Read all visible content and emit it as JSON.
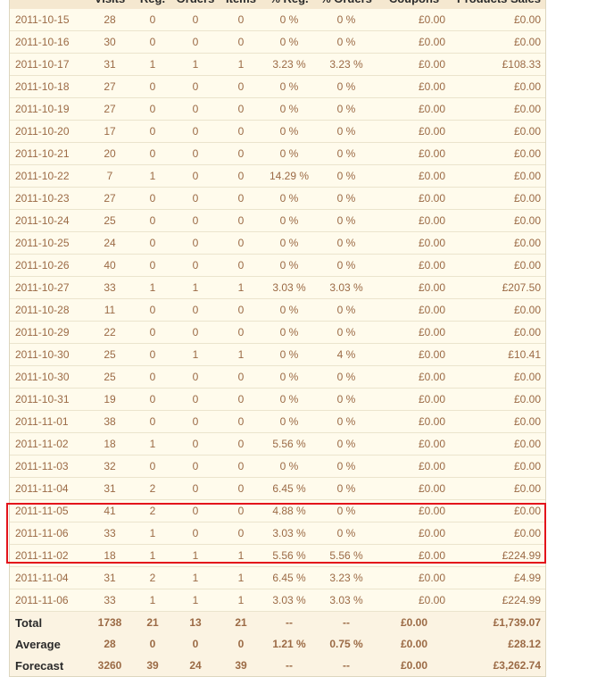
{
  "rows": [
    [
      "2011-10-15",
      "28",
      "0",
      "0",
      "0",
      "0 %",
      "0 %",
      "£0.00",
      "£0.00"
    ],
    [
      "2011-10-16",
      "30",
      "0",
      "0",
      "0",
      "0 %",
      "0 %",
      "£0.00",
      "£0.00"
    ],
    [
      "2011-10-17",
      "31",
      "1",
      "1",
      "1",
      "3.23 %",
      "3.23 %",
      "£0.00",
      "£108.33"
    ],
    [
      "2011-10-18",
      "27",
      "0",
      "0",
      "0",
      "0 %",
      "0 %",
      "£0.00",
      "£0.00"
    ],
    [
      "2011-10-19",
      "27",
      "0",
      "0",
      "0",
      "0 %",
      "0 %",
      "£0.00",
      "£0.00"
    ],
    [
      "2011-10-20",
      "17",
      "0",
      "0",
      "0",
      "0 %",
      "0 %",
      "£0.00",
      "£0.00"
    ],
    [
      "2011-10-21",
      "20",
      "0",
      "0",
      "0",
      "0 %",
      "0 %",
      "£0.00",
      "£0.00"
    ],
    [
      "2011-10-22",
      "7",
      "1",
      "0",
      "0",
      "14.29 %",
      "0 %",
      "£0.00",
      "£0.00"
    ],
    [
      "2011-10-23",
      "27",
      "0",
      "0",
      "0",
      "0 %",
      "0 %",
      "£0.00",
      "£0.00"
    ],
    [
      "2011-10-24",
      "25",
      "0",
      "0",
      "0",
      "0 %",
      "0 %",
      "£0.00",
      "£0.00"
    ],
    [
      "2011-10-25",
      "24",
      "0",
      "0",
      "0",
      "0 %",
      "0 %",
      "£0.00",
      "£0.00"
    ],
    [
      "2011-10-26",
      "40",
      "0",
      "0",
      "0",
      "0 %",
      "0 %",
      "£0.00",
      "£0.00"
    ],
    [
      "2011-10-27",
      "33",
      "1",
      "1",
      "1",
      "3.03 %",
      "3.03 %",
      "£0.00",
      "£207.50"
    ],
    [
      "2011-10-28",
      "11",
      "0",
      "0",
      "0",
      "0 %",
      "0 %",
      "£0.00",
      "£0.00"
    ],
    [
      "2011-10-29",
      "22",
      "0",
      "0",
      "0",
      "0 %",
      "0 %",
      "£0.00",
      "£0.00"
    ],
    [
      "2011-10-30",
      "25",
      "0",
      "1",
      "1",
      "0 %",
      "4 %",
      "£0.00",
      "£10.41"
    ],
    [
      "2011-10-30",
      "25",
      "0",
      "0",
      "0",
      "0 %",
      "0 %",
      "£0.00",
      "£0.00"
    ],
    [
      "2011-10-31",
      "19",
      "0",
      "0",
      "0",
      "0 %",
      "0 %",
      "£0.00",
      "£0.00"
    ],
    [
      "2011-11-01",
      "38",
      "0",
      "0",
      "0",
      "0 %",
      "0 %",
      "£0.00",
      "£0.00"
    ],
    [
      "2011-11-02",
      "18",
      "1",
      "0",
      "0",
      "5.56 %",
      "0 %",
      "£0.00",
      "£0.00"
    ],
    [
      "2011-11-03",
      "32",
      "0",
      "0",
      "0",
      "0 %",
      "0 %",
      "£0.00",
      "£0.00"
    ],
    [
      "2011-11-04",
      "31",
      "2",
      "0",
      "0",
      "6.45 %",
      "0 %",
      "£0.00",
      "£0.00"
    ],
    [
      "2011-11-05",
      "41",
      "2",
      "0",
      "0",
      "4.88 %",
      "0 %",
      "£0.00",
      "£0.00"
    ],
    [
      "2011-11-06",
      "33",
      "1",
      "0",
      "0",
      "3.03 %",
      "0 %",
      "£0.00",
      "£0.00"
    ],
    [
      "2011-11-02",
      "18",
      "1",
      "1",
      "1",
      "5.56 %",
      "5.56 %",
      "£0.00",
      "£224.99"
    ],
    [
      "2011-11-04",
      "31",
      "2",
      "1",
      "1",
      "6.45 %",
      "3.23 %",
      "£0.00",
      "£4.99"
    ],
    [
      "2011-11-06",
      "33",
      "1",
      "1",
      "1",
      "3.03 %",
      "3.03 %",
      "£0.00",
      "£224.99"
    ]
  ],
  "summary": {
    "columns": [
      "",
      "Visits",
      "Reg.",
      "Orders",
      "Items",
      "% Reg.",
      "% Orders",
      "Coupons",
      "Products Sales"
    ],
    "rows": [
      [
        "Total",
        "1738",
        "21",
        "13",
        "21",
        "--",
        "--",
        "£0.00",
        "£1,739.07"
      ],
      [
        "Average",
        "28",
        "0",
        "0",
        "0",
        "1.21 %",
        "0.75 %",
        "£0.00",
        "£28.12"
      ],
      [
        "Forecast",
        "3260",
        "39",
        "24",
        "39",
        "--",
        "--",
        "£0.00",
        "£3,262.74"
      ]
    ]
  },
  "colors": {
    "text": "#9b6a45",
    "background": "#fffbec",
    "header_background": "#f5e8d0",
    "highlight": "#e3141b"
  }
}
